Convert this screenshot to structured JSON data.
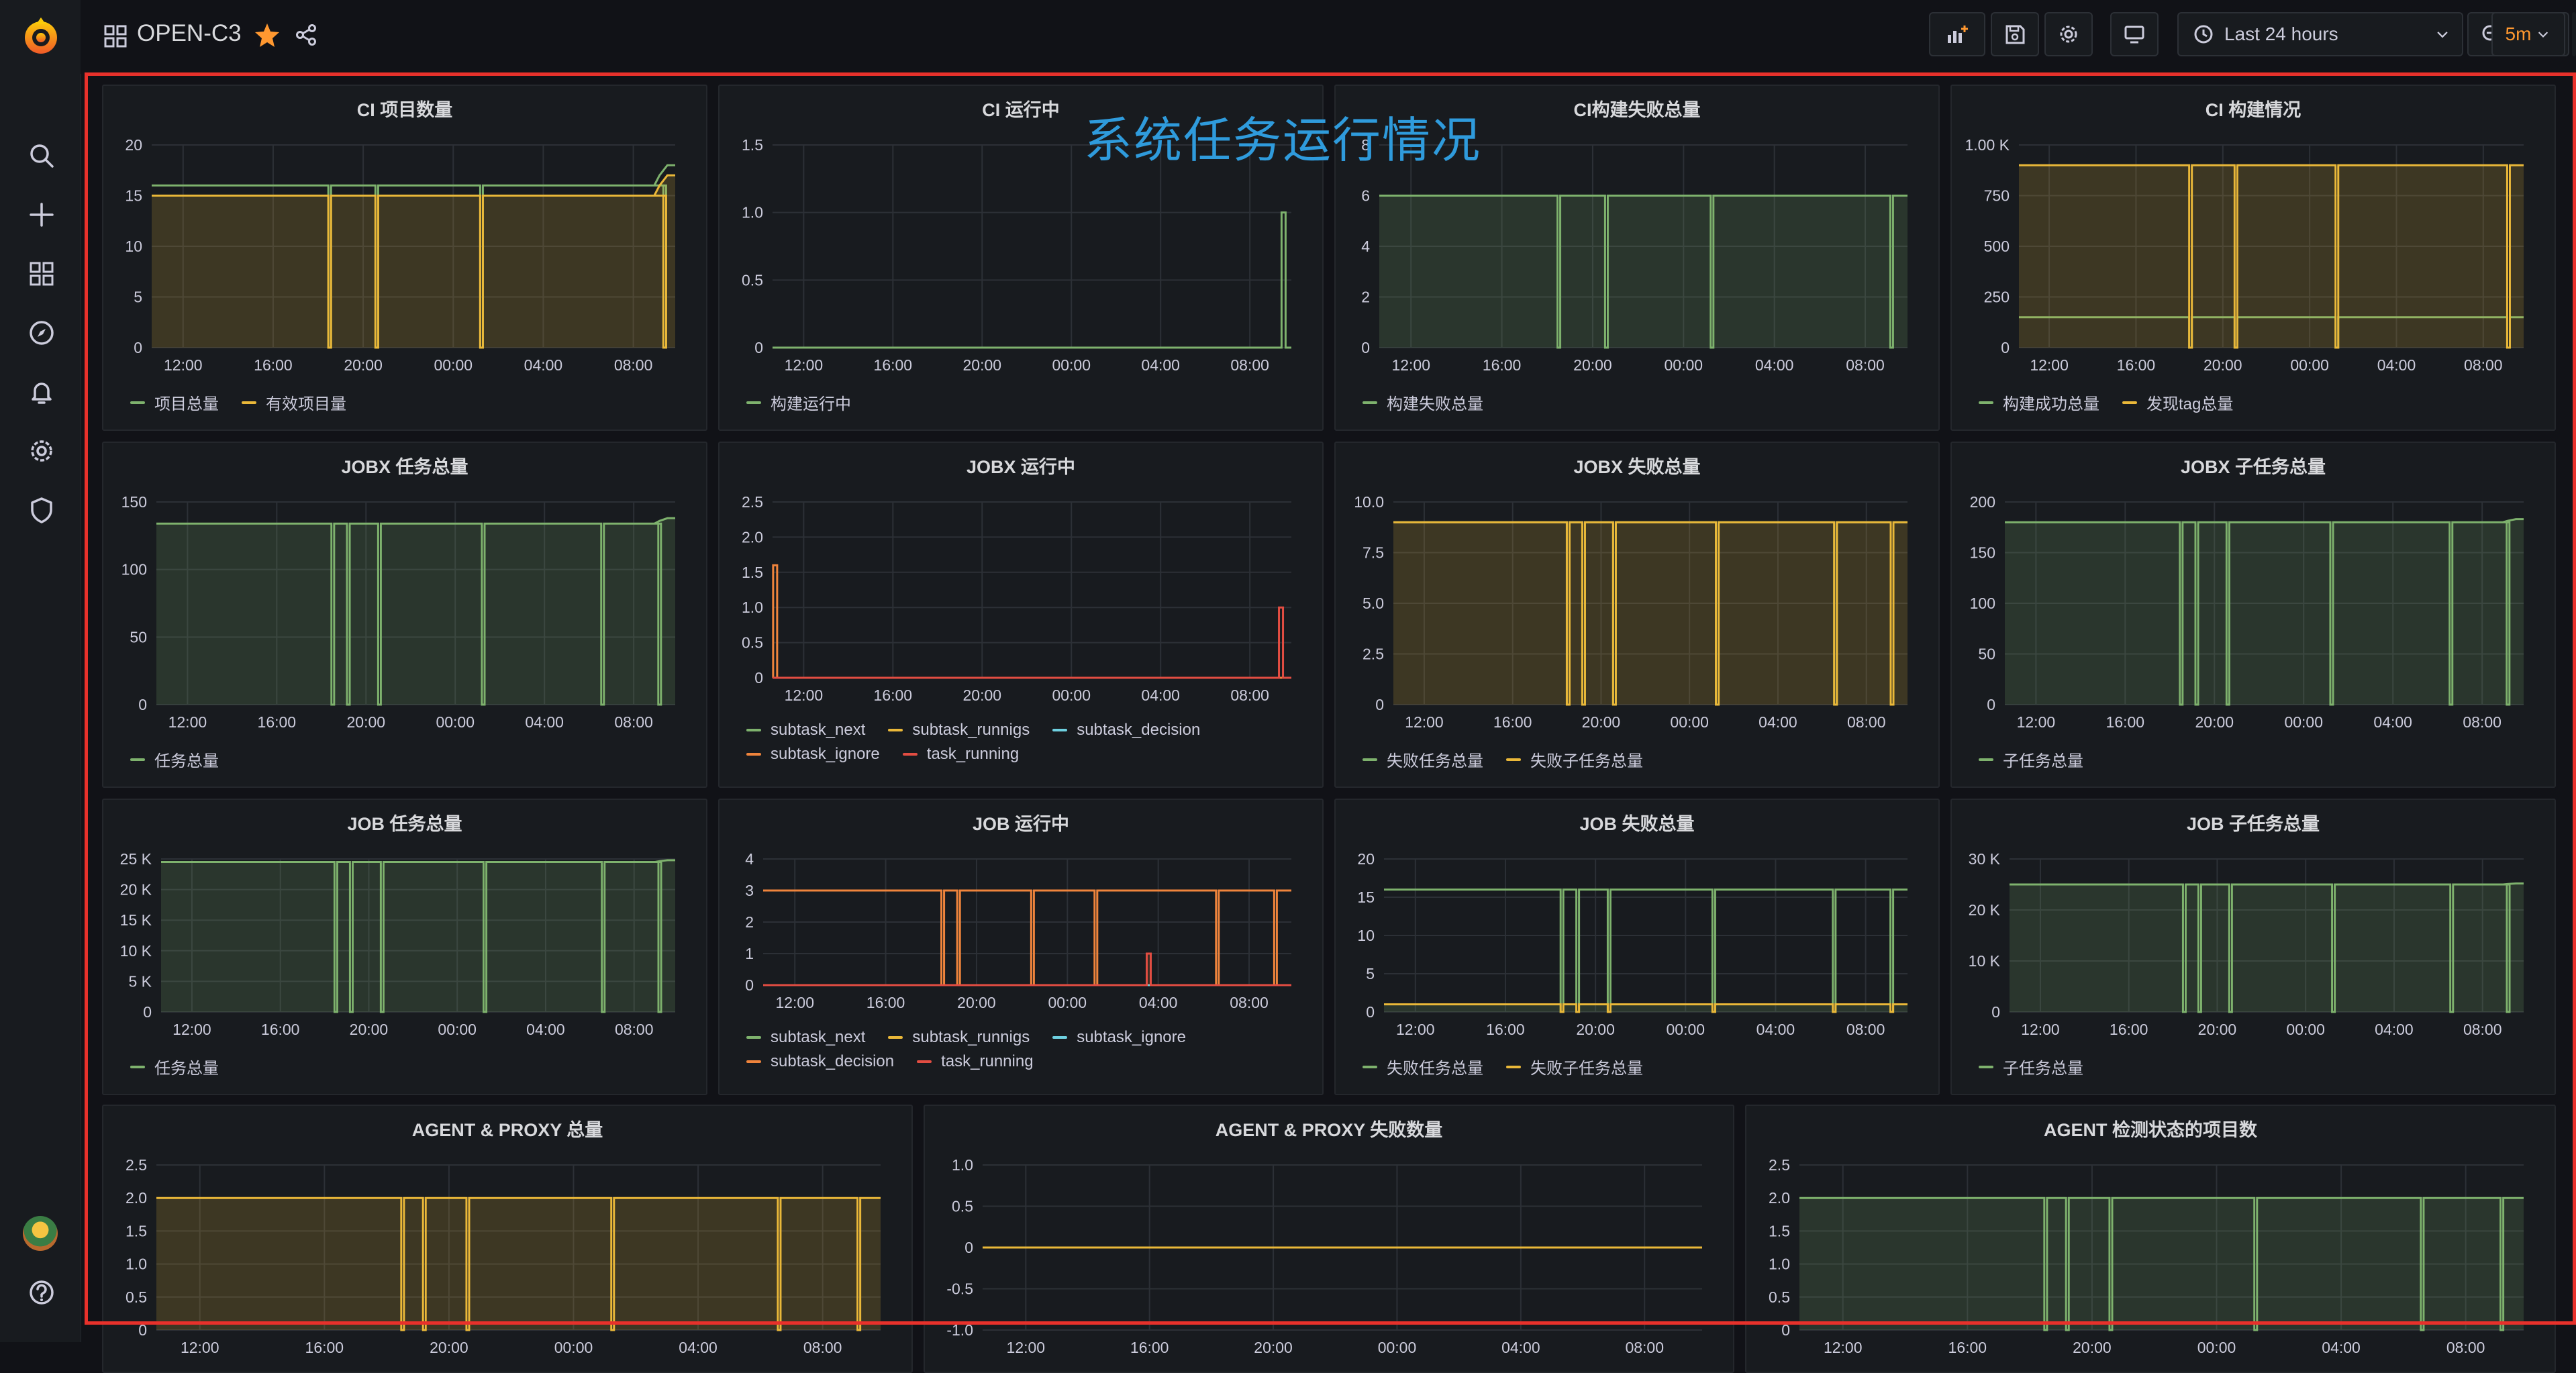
{
  "app": {
    "dashboard_title": "OPEN-C3",
    "overlay_title": "系统任务运行情况",
    "time_range": "Last 24 hours",
    "refresh_interval": "5m"
  },
  "sidebar": {
    "icons": [
      "grafana-logo-icon",
      "search-icon",
      "plus-icon",
      "dashboards-icon",
      "explore-icon",
      "alerting-icon",
      "settings-icon",
      "shield-icon",
      "avatar",
      "help-icon"
    ]
  },
  "toolbar": {
    "icons": [
      "add-panel-icon",
      "save-icon",
      "settings-icon",
      "tv-mode-icon",
      "clock-icon",
      "zoom-out-icon",
      "refresh-icon"
    ]
  },
  "colors": {
    "green": "#7eb26d",
    "yellow": "#eab839",
    "orange": "#ef843c",
    "red": "#e24d42",
    "teal": "#6ed0e0",
    "grid": "#2c3036",
    "axis_text": "#ccccdc"
  },
  "x_ticks": [
    "12:00",
    "16:00",
    "20:00",
    "00:00",
    "04:00",
    "08:00"
  ],
  "panels": [
    {
      "title": "CI 项目数量",
      "yticks": [
        "0",
        "5",
        "10",
        "15",
        "20"
      ],
      "ymax": 20,
      "fill_color": "#eab839",
      "series": [
        {
          "name": "项目总量",
          "color": "#7eb26d",
          "level": 16,
          "end_level": 18
        },
        {
          "name": "有效项目量",
          "color": "#eab839",
          "level": 15,
          "end_level": 17
        }
      ],
      "drops": [
        0.34,
        0.43,
        0.63,
        0.98
      ],
      "legend_rows": 1
    },
    {
      "title": "CI 运行中",
      "yticks": [
        "0",
        "0.5",
        "1.0",
        "1.5"
      ],
      "ymax": 1.5,
      "fill_color": "",
      "series": [
        {
          "name": "构建运行中",
          "color": "#7eb26d",
          "level": 0,
          "end_level": 0,
          "spike_at": 0.985,
          "spike_value": 1.0
        }
      ],
      "drops": [],
      "legend_rows": 1
    },
    {
      "title": "CI构建失败总量",
      "yticks": [
        "0",
        "2",
        "4",
        "6",
        "8"
      ],
      "ymax": 8,
      "fill_color": "#7eb26d",
      "series": [
        {
          "name": "构建失败总量",
          "color": "#7eb26d",
          "level": 6,
          "end_level": 6
        }
      ],
      "drops": [
        0.34,
        0.43,
        0.63,
        0.97
      ],
      "legend_rows": 1
    },
    {
      "title": "CI 构建情况",
      "yticks": [
        "0",
        "250",
        "500",
        "750",
        "1.00 K"
      ],
      "ymax": 1000,
      "fill_color": "#eab839",
      "series": [
        {
          "name": "构建成功总量",
          "color": "#7eb26d",
          "level": 150,
          "end_level": 150
        },
        {
          "name": "发现tag总量",
          "color": "#eab839",
          "level": 900,
          "end_level": 900
        }
      ],
      "drops": [
        0.34,
        0.43,
        0.63,
        0.97
      ],
      "legend_rows": 1
    },
    {
      "title": "JOBX 任务总量",
      "yticks": [
        "0",
        "50",
        "100",
        "150"
      ],
      "ymax": 150,
      "fill_color": "#7eb26d",
      "series": [
        {
          "name": "任务总量",
          "color": "#7eb26d",
          "level": 134,
          "end_level": 138
        }
      ],
      "drops": [
        0.34,
        0.37,
        0.43,
        0.63,
        0.86,
        0.97
      ],
      "legend_rows": 1
    },
    {
      "title": "JOBX 运行中",
      "yticks": [
        "0",
        "0.5",
        "1.0",
        "1.5",
        "2.0",
        "2.5"
      ],
      "ymax": 2.5,
      "fill_color": "",
      "series": [
        {
          "name": "subtask_next",
          "color": "#7eb26d",
          "level": 0,
          "end_level": 0
        },
        {
          "name": "subtask_runnigs",
          "color": "#eab839",
          "level": 0,
          "end_level": 0
        },
        {
          "name": "subtask_decision",
          "color": "#6ed0e0",
          "level": 0,
          "end_level": 0
        },
        {
          "name": "subtask_ignore",
          "color": "#ef843c",
          "level": 0,
          "end_level": 0,
          "spike_at": 0.005,
          "spike_value": 1.6
        },
        {
          "name": "task_running",
          "color": "#e24d42",
          "level": 0,
          "end_level": 0,
          "spike_at": 0.98,
          "spike_value": 1.0
        }
      ],
      "drops": [],
      "legend_rows": 2
    },
    {
      "title": "JOBX 失败总量",
      "yticks": [
        "0",
        "2.5",
        "5.0",
        "7.5",
        "10.0"
      ],
      "ymax": 10,
      "fill_color": "#eab839",
      "series": [
        {
          "name": "失败任务总量",
          "color": "#7eb26d",
          "level": 9,
          "end_level": 9
        },
        {
          "name": "失败子任务总量",
          "color": "#eab839",
          "level": 9,
          "end_level": 9
        }
      ],
      "drops": [
        0.34,
        0.37,
        0.43,
        0.63,
        0.86,
        0.97
      ],
      "legend_rows": 1
    },
    {
      "title": "JOBX 子任务总量",
      "yticks": [
        "0",
        "50",
        "100",
        "150",
        "200"
      ],
      "ymax": 200,
      "fill_color": "#7eb26d",
      "series": [
        {
          "name": "子任务总量",
          "color": "#7eb26d",
          "level": 180,
          "end_level": 183
        }
      ],
      "drops": [
        0.34,
        0.37,
        0.43,
        0.63,
        0.86,
        0.97
      ],
      "legend_rows": 1
    },
    {
      "title": "JOB 任务总量",
      "yticks": [
        "0",
        "5 K",
        "10 K",
        "15 K",
        "20 K",
        "25 K"
      ],
      "ymax": 25000,
      "fill_color": "#7eb26d",
      "series": [
        {
          "name": "任务总量",
          "color": "#7eb26d",
          "level": 24500,
          "end_level": 24800
        }
      ],
      "drops": [
        0.34,
        0.37,
        0.43,
        0.63,
        0.86,
        0.97
      ],
      "legend_rows": 1
    },
    {
      "title": "JOB 运行中",
      "yticks": [
        "0",
        "1",
        "2",
        "3",
        "4"
      ],
      "ymax": 4,
      "fill_color": "#ef843c",
      "series": [
        {
          "name": "subtask_next",
          "color": "#7eb26d",
          "level": 0,
          "end_level": 0
        },
        {
          "name": "subtask_runnigs",
          "color": "#eab839",
          "level": 0,
          "end_level": 0
        },
        {
          "name": "subtask_ignore",
          "color": "#6ed0e0",
          "level": 0,
          "end_level": 0
        },
        {
          "name": "subtask_decision",
          "color": "#ef843c",
          "level": 3,
          "end_level": 3
        },
        {
          "name": "task_running",
          "color": "#e24d42",
          "level": 0,
          "end_level": 0,
          "spike_at": 0.73,
          "spike_value": 1.0
        }
      ],
      "drops": [
        0.34,
        0.37,
        0.51,
        0.63,
        0.86,
        0.97
      ],
      "legend_rows": 2
    },
    {
      "title": "JOB 失败总量",
      "yticks": [
        "0",
        "5",
        "10",
        "15",
        "20"
      ],
      "ymax": 20,
      "fill_color": "#7eb26d",
      "series": [
        {
          "name": "失败任务总量",
          "color": "#7eb26d",
          "level": 16,
          "end_level": 16
        },
        {
          "name": "失败子任务总量",
          "color": "#eab839",
          "level": 1,
          "end_level": 1
        }
      ],
      "drops": [
        0.34,
        0.37,
        0.43,
        0.63,
        0.86,
        0.97
      ],
      "legend_rows": 1
    },
    {
      "title": "JOB 子任务总量",
      "yticks": [
        "0",
        "10 K",
        "20 K",
        "30 K"
      ],
      "ymax": 30000,
      "fill_color": "#7eb26d",
      "series": [
        {
          "name": "子任务总量",
          "color": "#7eb26d",
          "level": 25000,
          "end_level": 25200
        }
      ],
      "drops": [
        0.34,
        0.37,
        0.43,
        0.63,
        0.86,
        0.97
      ],
      "legend_rows": 1
    },
    {
      "title": "AGENT & PROXY 总量",
      "yticks": [
        "0",
        "0.5",
        "1.0",
        "1.5",
        "2.0",
        "2.5"
      ],
      "ymax": 2.5,
      "fill_color": "#eab839",
      "series": [
        {
          "name": "",
          "color": "#eab839",
          "level": 2,
          "end_level": 2
        }
      ],
      "drops": [
        0.34,
        0.37,
        0.43,
        0.63,
        0.86,
        0.97
      ],
      "legend_rows": 0
    },
    {
      "title": "AGENT & PROXY 失败数量",
      "yticks": [
        "-1.0",
        "-0.5",
        "0",
        "0.5",
        "1.0"
      ],
      "ymin": -1,
      "ymax": 1,
      "fill_color": "",
      "series": [
        {
          "name": "",
          "color": "#eab839",
          "level": 0,
          "end_level": 0
        }
      ],
      "drops": [],
      "legend_rows": 0
    },
    {
      "title": "AGENT 检测状态的项目数",
      "yticks": [
        "0",
        "0.5",
        "1.0",
        "1.5",
        "2.0",
        "2.5"
      ],
      "ymax": 2.5,
      "fill_color": "#7eb26d",
      "series": [
        {
          "name": "",
          "color": "#7eb26d",
          "level": 2,
          "end_level": 2
        }
      ],
      "drops": [
        0.34,
        0.37,
        0.43,
        0.63,
        0.86,
        0.97
      ],
      "legend_rows": 0
    }
  ]
}
